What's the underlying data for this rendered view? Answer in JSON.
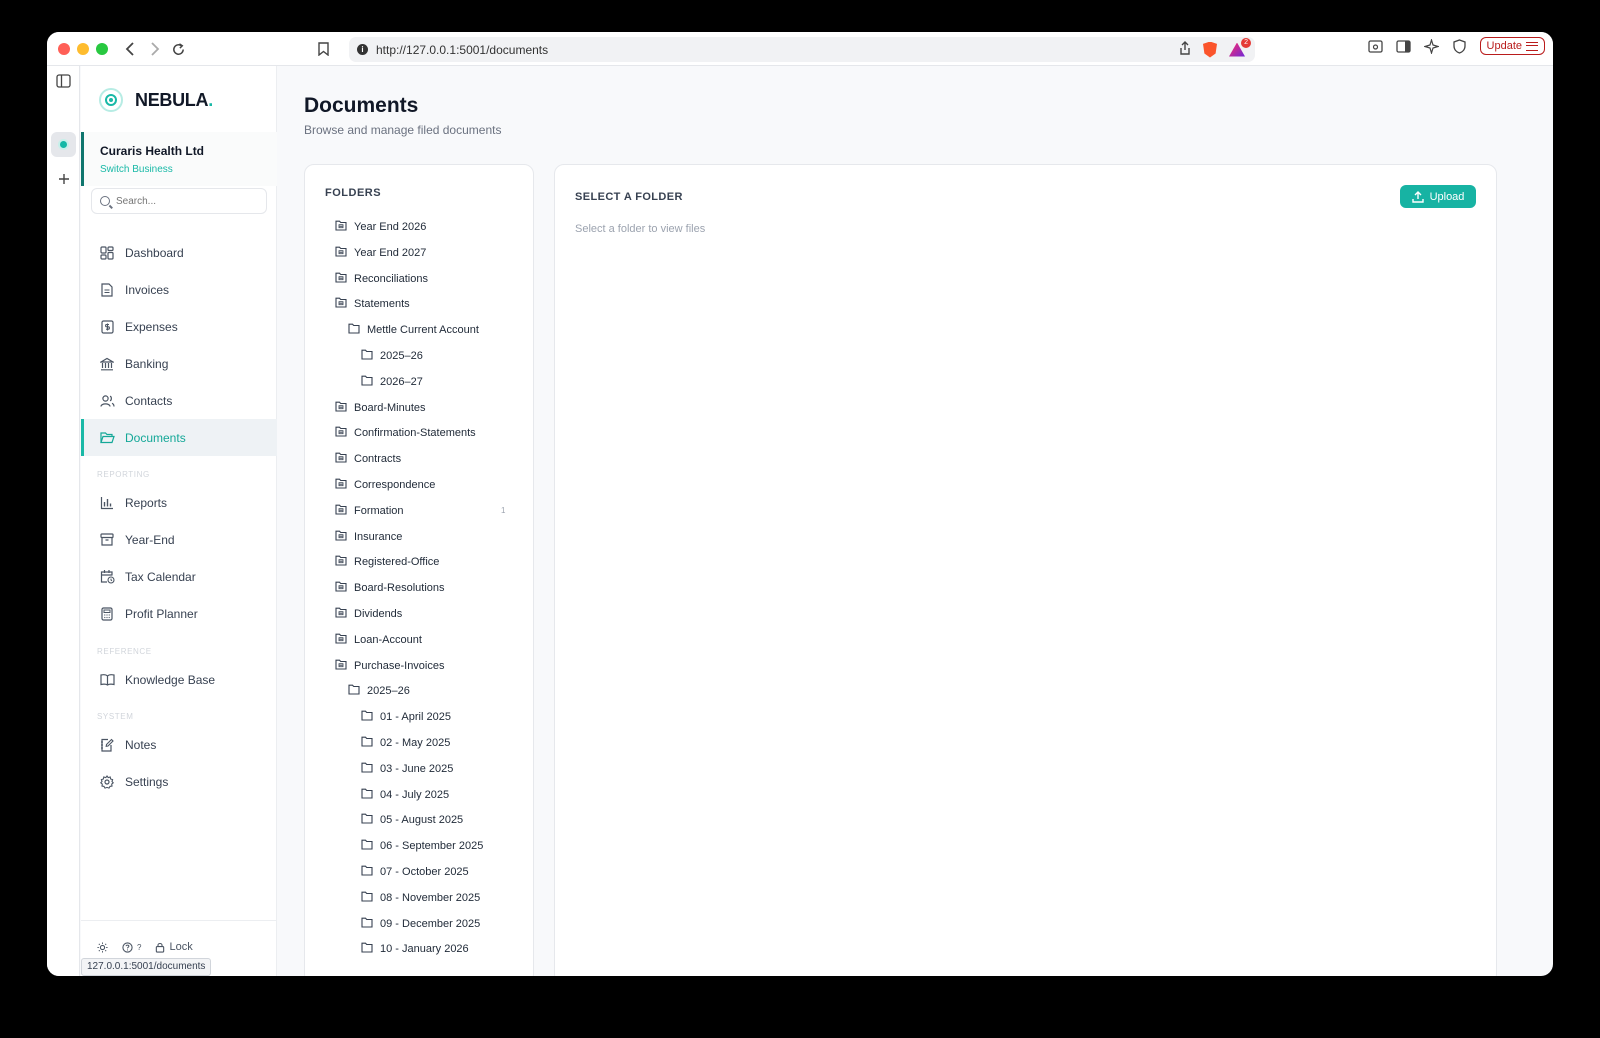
{
  "browser": {
    "url": "http://127.0.0.1:5001/documents",
    "update_label": "Update",
    "badge_count": "2",
    "status_url": "127.0.0.1:5001/documents"
  },
  "app": {
    "logo": "NEBULA",
    "logo_dot": ".",
    "accent_color": "#19b9a7"
  },
  "business": {
    "name": "Curaris Health Ltd",
    "switch_label": "Switch Business"
  },
  "search": {
    "placeholder": "Search..."
  },
  "nav": {
    "items": [
      {
        "label": "Dashboard",
        "icon": "grid-icon"
      },
      {
        "label": "Invoices",
        "icon": "file-text-icon"
      },
      {
        "label": "Expenses",
        "icon": "receipt-icon"
      },
      {
        "label": "Banking",
        "icon": "bank-icon"
      },
      {
        "label": "Contacts",
        "icon": "users-icon"
      },
      {
        "label": "Documents",
        "icon": "folder-open-icon"
      }
    ],
    "reporting_label": "REPORTING",
    "reporting": [
      {
        "label": "Reports",
        "icon": "bar-chart-icon"
      },
      {
        "label": "Year-End",
        "icon": "archive-icon"
      },
      {
        "label": "Tax Calendar",
        "icon": "calendar-clock-icon"
      },
      {
        "label": "Profit Planner",
        "icon": "calculator-icon"
      }
    ],
    "reference_label": "REFERENCE",
    "reference": [
      {
        "label": "Knowledge Base",
        "icon": "book-open-icon"
      }
    ],
    "system_label": "SYSTEM",
    "system": [
      {
        "label": "Notes",
        "icon": "notebook-pen-icon"
      },
      {
        "label": "Settings",
        "icon": "gear-icon"
      }
    ]
  },
  "footer": {
    "help": "?",
    "lock": "Lock"
  },
  "page": {
    "title": "Documents",
    "subtitle": "Browse and manage filed documents"
  },
  "folders": {
    "header": "FOLDERS",
    "items": [
      {
        "label": "Year End 2026",
        "level": 0,
        "type": "closed"
      },
      {
        "label": "Year End 2027",
        "level": 0,
        "type": "closed"
      },
      {
        "label": "Reconciliations",
        "level": 0,
        "type": "closed"
      },
      {
        "label": "Statements",
        "level": 0,
        "type": "closed"
      },
      {
        "label": "Mettle Current Account",
        "level": 1,
        "type": "plain"
      },
      {
        "label": "2025–26",
        "level": 2,
        "type": "plain"
      },
      {
        "label": "2026–27",
        "level": 2,
        "type": "plain"
      },
      {
        "label": "Board-Minutes",
        "level": 0,
        "type": "closed"
      },
      {
        "label": "Confirmation-Statements",
        "level": 0,
        "type": "closed"
      },
      {
        "label": "Contracts",
        "level": 0,
        "type": "closed"
      },
      {
        "label": "Correspondence",
        "level": 0,
        "type": "closed"
      },
      {
        "label": "Formation",
        "level": 0,
        "type": "closed",
        "count": "1"
      },
      {
        "label": "Insurance",
        "level": 0,
        "type": "closed"
      },
      {
        "label": "Registered-Office",
        "level": 0,
        "type": "closed"
      },
      {
        "label": "Board-Resolutions",
        "level": 0,
        "type": "closed"
      },
      {
        "label": "Dividends",
        "level": 0,
        "type": "closed"
      },
      {
        "label": "Loan-Account",
        "level": 0,
        "type": "closed"
      },
      {
        "label": "Purchase-Invoices",
        "level": 0,
        "type": "closed"
      },
      {
        "label": "2025–26",
        "level": 1,
        "type": "plain"
      },
      {
        "label": "01 - April 2025",
        "level": 2,
        "type": "plain"
      },
      {
        "label": "02 - May 2025",
        "level": 2,
        "type": "plain"
      },
      {
        "label": "03 - June 2025",
        "level": 2,
        "type": "plain"
      },
      {
        "label": "04 - July 2025",
        "level": 2,
        "type": "plain"
      },
      {
        "label": "05 - August 2025",
        "level": 2,
        "type": "plain"
      },
      {
        "label": "06 - September 2025",
        "level": 2,
        "type": "plain"
      },
      {
        "label": "07 - October 2025",
        "level": 2,
        "type": "plain"
      },
      {
        "label": "08 - November 2025",
        "level": 2,
        "type": "plain"
      },
      {
        "label": "09 - December 2025",
        "level": 2,
        "type": "plain"
      },
      {
        "label": "10 - January 2026",
        "level": 2,
        "type": "plain"
      }
    ]
  },
  "content": {
    "header": "SELECT A FOLDER",
    "hint": "Select a folder to view files",
    "upload_label": "Upload"
  }
}
